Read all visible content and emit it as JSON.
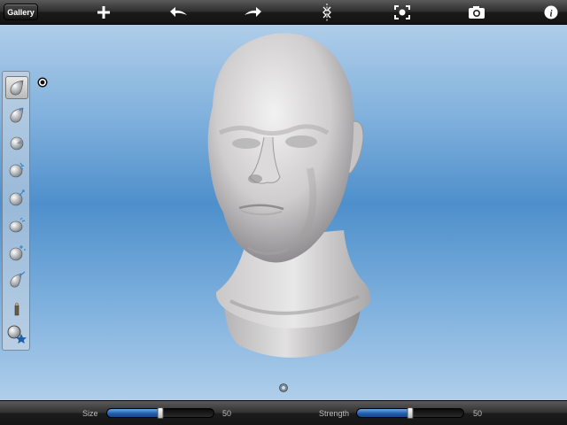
{
  "toolbar": {
    "gallery_label": "Gallery",
    "icons": [
      "plus-icon",
      "undo-arrow-icon",
      "redo-arrow-icon",
      "symmetry-icon",
      "reset-view-icon",
      "camera-icon",
      "info-icon"
    ]
  },
  "tools": [
    {
      "name": "draw-tool-icon",
      "selected": true
    },
    {
      "name": "inflate-tool-icon",
      "selected": false
    },
    {
      "name": "pinch-tool-icon",
      "selected": false
    },
    {
      "name": "flatten-tool-icon",
      "selected": false
    },
    {
      "name": "grab-tool-icon",
      "selected": false
    },
    {
      "name": "smooth-tool-icon",
      "selected": false
    },
    {
      "name": "crease-tool-icon",
      "selected": false
    },
    {
      "name": "brush-stroke-tool-icon",
      "selected": false
    },
    {
      "name": "paint-tool-icon",
      "selected": false
    },
    {
      "name": "material-tool-icon",
      "selected": false
    }
  ],
  "sliders": {
    "size": {
      "label": "Size",
      "value": "50",
      "fraction": 0.5
    },
    "strength": {
      "label": "Strength",
      "value": "50",
      "fraction": 0.5
    }
  },
  "colors": {
    "accent_blue": "#1f5fb0",
    "background_mid": "#4e8fcb",
    "model_gray": "#cfcfcf"
  }
}
